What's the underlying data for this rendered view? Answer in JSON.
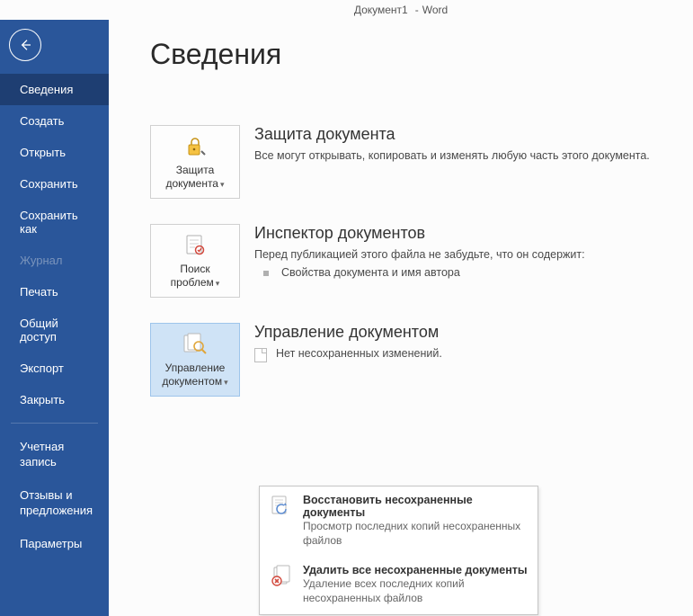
{
  "titlebar": {
    "doc": "Документ1",
    "sep": "-",
    "app": "Word"
  },
  "sidebar": {
    "items": [
      {
        "label": "Сведения",
        "selected": true
      },
      {
        "label": "Создать"
      },
      {
        "label": "Открыть"
      },
      {
        "label": "Сохранить"
      },
      {
        "label": "Сохранить как"
      },
      {
        "label": "Журнал",
        "disabled": true
      },
      {
        "label": "Печать"
      },
      {
        "label": "Общий доступ"
      },
      {
        "label": "Экспорт"
      },
      {
        "label": "Закрыть"
      }
    ],
    "footer": [
      {
        "label": "Учетная запись"
      },
      {
        "label": "Отзывы и предложения"
      },
      {
        "label": "Параметры"
      }
    ]
  },
  "page": {
    "title": "Сведения"
  },
  "protect": {
    "button_l1": "Защита",
    "button_l2": "документа",
    "title": "Защита документа",
    "desc": "Все могут открывать, копировать и изменять любую часть этого документа."
  },
  "inspect": {
    "button_l1": "Поиск",
    "button_l2": "проблем",
    "title": "Инспектор документов",
    "desc": "Перед публикацией этого файла не забудьте, что он содержит:",
    "bullet": "Свойства документа и имя автора"
  },
  "manage": {
    "button_l1": "Управление",
    "button_l2": "документом",
    "title": "Управление документом",
    "none": "Нет несохраненных изменений."
  },
  "popup": {
    "recover_title": "Восстановить несохраненные документы",
    "recover_desc": "Просмотр последних копий несохраненных файлов",
    "delete_title": "Удалить все несохраненные документы",
    "delete_desc": "Удаление всех последних копий несохраненных файлов"
  }
}
